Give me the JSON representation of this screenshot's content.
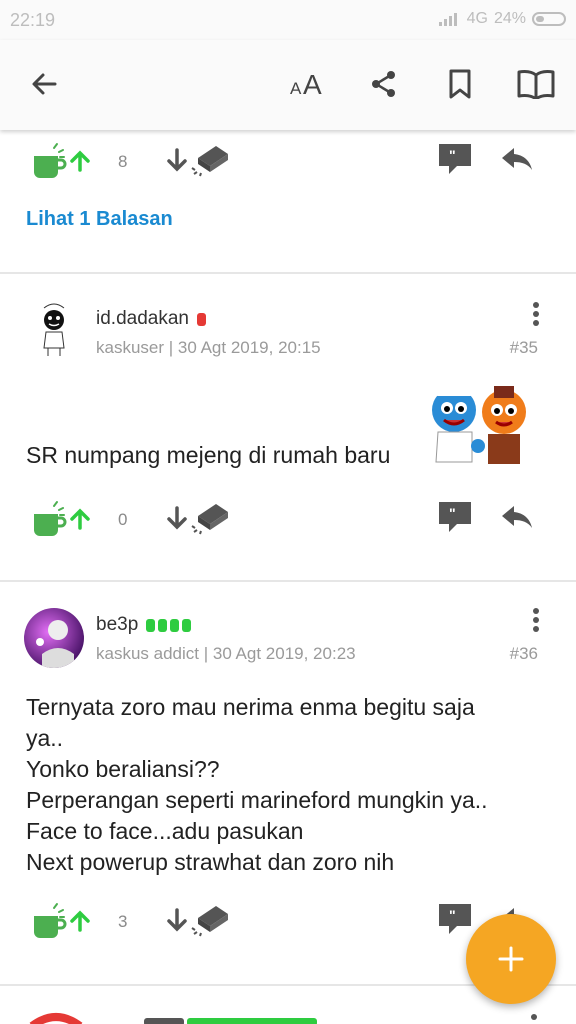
{
  "statusbar": {
    "time": "22:19",
    "network": "4G",
    "battery": "24%"
  },
  "toolbar": {
    "back": "back-arrow",
    "font_size": "font-size",
    "share": "share",
    "bookmark": "bookmark",
    "read": "open-book"
  },
  "top_post": {
    "up_count": "8",
    "lihat_balasan": "Lihat 1 Balasan"
  },
  "posts": [
    {
      "username": "id.dadakan",
      "rank_color": "#e53935",
      "meta": "kaskuser | 30 Agt 2019, 20:15",
      "number": "#35",
      "text_lines": [
        "SR numpang mejeng di rumah baru"
      ],
      "up_count": "0"
    },
    {
      "username": "be3p",
      "rank_color": "#2ecc40",
      "meta": "kaskus addict | 30 Agt 2019, 20:23",
      "number": "#36",
      "text_lines": [
        "Ternyata zoro mau nerima enma begitu saja",
        "ya..",
        "Yonko beraliansi??",
        "Perperangan seperti marineford mungkin ya..",
        "Face to face...adu pasukan",
        "Next powerup strawhat dan zoro nih"
      ],
      "up_count": "3"
    }
  ],
  "colors": {
    "accent_blue": "#1a8ad1",
    "cendol_green": "#4caf50",
    "fab_orange": "#f5a623"
  }
}
